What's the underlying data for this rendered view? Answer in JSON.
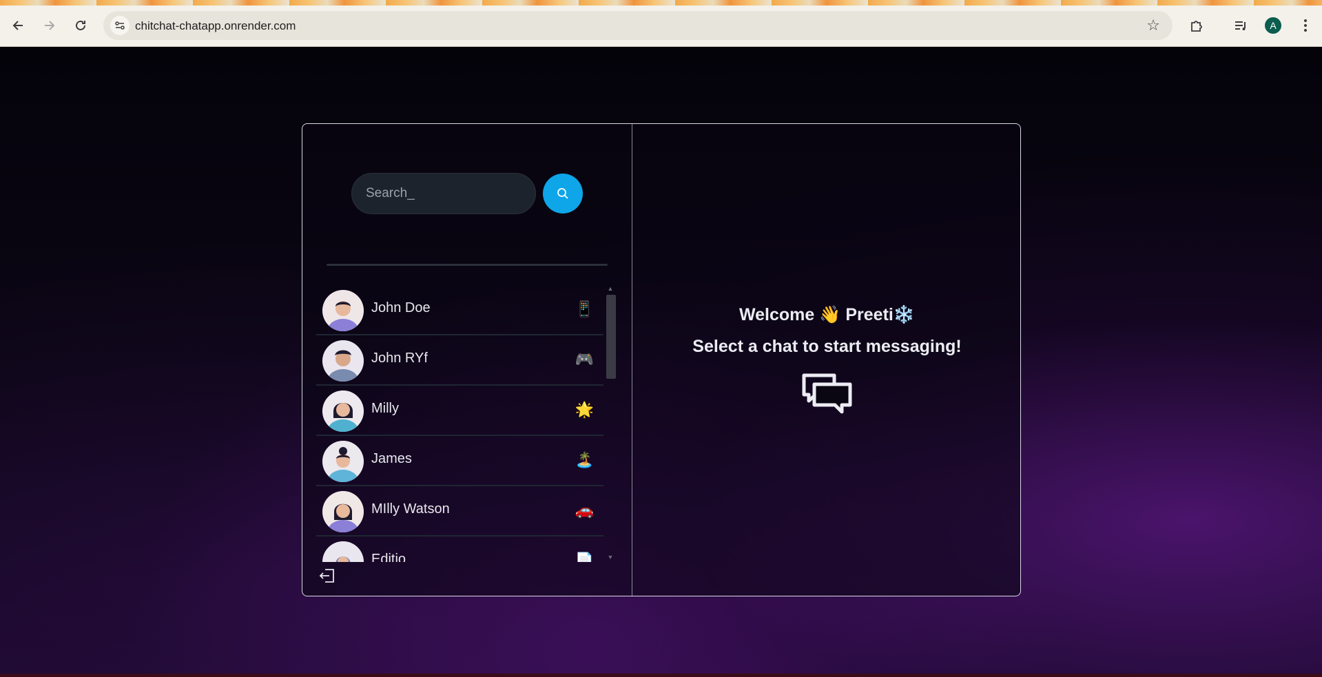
{
  "browser": {
    "url": "chitchat-chatapp.onrender.com",
    "profile_initial": "A"
  },
  "sidebar": {
    "search_placeholder": "Search_",
    "contacts": [
      {
        "name": "John Doe",
        "emoji": "📱",
        "avatar_color": "#8b7fd8"
      },
      {
        "name": "John RYf",
        "emoji": "🎮",
        "avatar_color": "#7a8bb0"
      },
      {
        "name": "Milly",
        "emoji": "🌟",
        "avatar_color": "#4fb1cf"
      },
      {
        "name": "James",
        "emoji": "🏝️",
        "avatar_color": "#5fb4d9"
      },
      {
        "name": "MIlly Watson",
        "emoji": "🚗",
        "avatar_color": "#8b7fd8"
      },
      {
        "name": "Editio",
        "emoji": "📄",
        "avatar_color": "#6c7bb0"
      }
    ]
  },
  "main": {
    "welcome_prefix": "Welcome",
    "wave_emoji": "👋",
    "username": "Preeti",
    "snow_emoji": "❄️",
    "prompt": "Select a chat to start messaging!"
  },
  "colors": {
    "accent": "#0ea5e9",
    "frame_border": "#d9d9e6"
  }
}
